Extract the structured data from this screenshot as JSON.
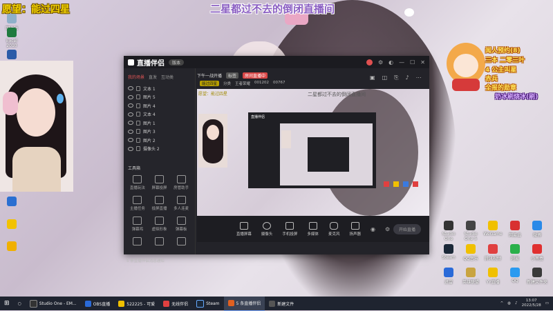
{
  "overlay": {
    "wish": "愿望：能过四星",
    "banner": "二星都过不去的倒闭直播间"
  },
  "right_overlay": {
    "items": [
      "闻人预约(8)",
      "三本 二零三叶",
      "4 公主叫星",
      "赤兵",
      "全报的勋章",
      "奶冰刷烧冰(刷)"
    ]
  },
  "window": {
    "logo": "直播伴侣",
    "version": "版本",
    "left_tabs": [
      "我的场景",
      "直发",
      "互动类"
    ],
    "sources": [
      "文本 1",
      "图片 5",
      "图片 4",
      "文本 4",
      "图片 1",
      "图片 3",
      "图片 2",
      "摄像头 2"
    ],
    "tools_title": "工具箱",
    "tools": [
      "直播玩法",
      "屏幕投屏",
      "房管助手",
      "主播任务",
      "投屏直播",
      "多人连麦",
      "弹幕鸡",
      "虚拟形象",
      "弹幕板",
      "",
      "",
      ""
    ],
    "warn": "5 条直播伴侣消息通知",
    "stream_title": "下午一战开播",
    "tag_gray": "标签",
    "tag_red": "房间直播中",
    "sub": [
      "能过四星",
      "分类",
      "王者荣耀",
      "001202",
      "00767"
    ],
    "preview_wish": "愿望：能过四星",
    "preview_banner": "二星都过不去的倒闭直播间",
    "controls": [
      "直播屏幕",
      "摄像头",
      "手机投屏",
      "多媒体",
      "麦克风",
      "扬声器"
    ],
    "start": "开始直播"
  },
  "desktop_icons": [
    "Studio One",
    "Studio One 5",
    "WeGame",
    "网易云",
    "微博",
    "Steam",
    "QQ音乐",
    "腾讯视频",
    "网易",
    "小黑盒",
    "迅雷",
    "英雄联盟",
    "YY直播",
    "QQ",
    "新建文件夹"
  ],
  "left_icons": [
    "回收站",
    "Excel 2010",
    "Word",
    "王者荣耀",
    "腾讯会议",
    "虎牙直播"
  ],
  "taskbar": {
    "items": [
      "Studio One - EM...",
      "OBS直播",
      "522225 - 可爱",
      "无线伴侣",
      "Steam",
      "5 条直播伴侣",
      "新建文件"
    ],
    "time": "13:07",
    "date": "2022/5/28"
  },
  "colors": {
    "accent_red": "#e25656",
    "overlay_yellow": "#f0d000",
    "banner_purple": "#8a5ec2"
  }
}
